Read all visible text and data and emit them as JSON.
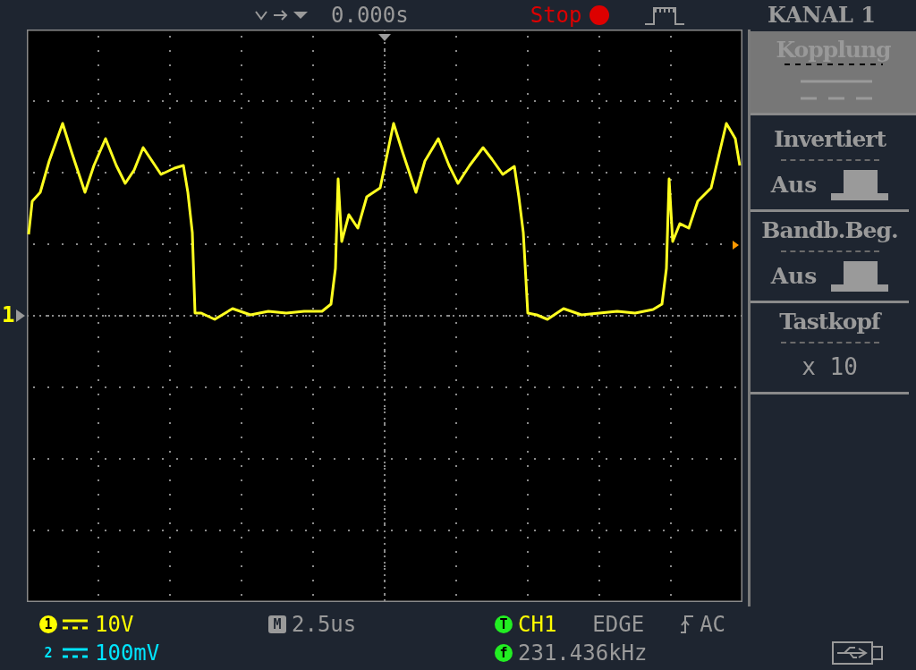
{
  "top_bar": {
    "trigger_time": "0.000s",
    "run_state": "Stop",
    "running": false
  },
  "channel_marker": "1",
  "menu": {
    "title": "KANAL 1",
    "items": [
      {
        "label": "Kopplung",
        "kind": "coupling",
        "selected": true
      },
      {
        "label": "Invertiert",
        "kind": "toggle",
        "value": "Aus",
        "selected": false
      },
      {
        "label": "Bandb.Beg.",
        "kind": "toggle",
        "value": "Aus",
        "selected": false
      },
      {
        "label": "Tastkopf",
        "kind": "text",
        "value": "x 10",
        "selected": false
      }
    ]
  },
  "status": {
    "channels": [
      {
        "badge": "1",
        "scale": "10V",
        "color": "#ffff00"
      },
      {
        "badge": "2",
        "scale": "100mV",
        "color": "#00e5ff"
      }
    ],
    "timebase_badge": "M",
    "timebase": "2.5us",
    "trigger_badge": "T",
    "trigger_source": "CH1",
    "trigger_type": "EDGE",
    "trigger_coupling": "AC",
    "frequency_badge": "f",
    "frequency": "231.436kHz"
  }
}
